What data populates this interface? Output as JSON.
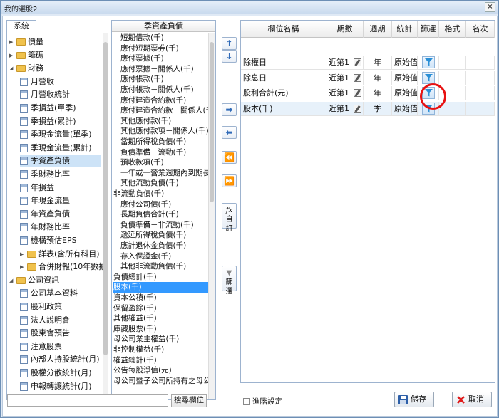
{
  "window": {
    "title": "我的選股2",
    "close_glyph": "×"
  },
  "left_tab": "系統",
  "tree": [
    {
      "label": "價量",
      "type": "folder",
      "level": 0,
      "expand": "▶"
    },
    {
      "label": "籌碼",
      "type": "folder",
      "level": 0,
      "expand": "▶"
    },
    {
      "label": "財務",
      "type": "folder",
      "level": 0,
      "expand": "◢"
    },
    {
      "label": "月營收",
      "type": "doc",
      "level": 1
    },
    {
      "label": "月營收統計",
      "type": "doc",
      "level": 1
    },
    {
      "label": "季損益(單季)",
      "type": "doc",
      "level": 1
    },
    {
      "label": "季損益(累計)",
      "type": "doc",
      "level": 1
    },
    {
      "label": "季現金流量(單季)",
      "type": "doc",
      "level": 1
    },
    {
      "label": "季現金流量(累計)",
      "type": "doc",
      "level": 1
    },
    {
      "label": "季資產負債",
      "type": "doc",
      "level": 1,
      "selected": true
    },
    {
      "label": "季財務比率",
      "type": "doc",
      "level": 1
    },
    {
      "label": "年損益",
      "type": "doc",
      "level": 1
    },
    {
      "label": "年現金流量",
      "type": "doc",
      "level": 1
    },
    {
      "label": "年資產負債",
      "type": "doc",
      "level": 1
    },
    {
      "label": "年財務比率",
      "type": "doc",
      "level": 1
    },
    {
      "label": "機構預估EPS",
      "type": "doc",
      "level": 1
    },
    {
      "label": "詳表(含所有科目)",
      "type": "folder",
      "level": 1,
      "expand": "▶"
    },
    {
      "label": "合併財報(10年數據)",
      "type": "folder",
      "level": 1,
      "expand": "▶"
    },
    {
      "label": "公司資訊",
      "type": "folder",
      "level": 0,
      "expand": "◢"
    },
    {
      "label": "公司基本資料",
      "type": "doc",
      "level": 1
    },
    {
      "label": "股利政策",
      "type": "doc",
      "level": 1
    },
    {
      "label": "法人說明會",
      "type": "doc",
      "level": 1
    },
    {
      "label": "股東會預告",
      "type": "doc",
      "level": 1
    },
    {
      "label": "注意股票",
      "type": "doc",
      "level": 1
    },
    {
      "label": "內部人持股統計(月)",
      "type": "doc",
      "level": 1
    },
    {
      "label": "股權分散統計(月)",
      "type": "doc",
      "level": 1
    },
    {
      "label": "申報轉讓統計(月)",
      "type": "doc",
      "level": 1
    }
  ],
  "field_list": {
    "header": "季資產負債",
    "items": [
      {
        "label": "短期借款(千)",
        "indent": 1
      },
      {
        "label": "應付短期票券(千)",
        "indent": 1
      },
      {
        "label": "應付票據(千)",
        "indent": 1
      },
      {
        "label": "應付票據－關係人(千)",
        "indent": 1
      },
      {
        "label": "應付帳款(千)",
        "indent": 1
      },
      {
        "label": "應付帳款－關係人(千)",
        "indent": 1
      },
      {
        "label": "應付建造合約款(千)",
        "indent": 1
      },
      {
        "label": "應付建造合約款－關係人(千)",
        "indent": 1
      },
      {
        "label": "其他應付款(千)",
        "indent": 1
      },
      {
        "label": "其他應付款項－關係人(千)",
        "indent": 1
      },
      {
        "label": "當期所得稅負債(千)",
        "indent": 1
      },
      {
        "label": "負債準備－流動(千)",
        "indent": 1
      },
      {
        "label": "預收款項(千)",
        "indent": 1
      },
      {
        "label": "一年或一營業週期內到期長期",
        "indent": 1
      },
      {
        "label": "其他流動負債(千)",
        "indent": 1
      },
      {
        "label": "非流動負債(千)",
        "indent": 0
      },
      {
        "label": "應付公司債(千)",
        "indent": 1
      },
      {
        "label": "長期負債合計(千)",
        "indent": 1
      },
      {
        "label": "負債準備－非流動(千)",
        "indent": 1
      },
      {
        "label": "遞延所得稅負債(千)",
        "indent": 1
      },
      {
        "label": "應計退休金負債(千)",
        "indent": 1
      },
      {
        "label": "存入保證金(千)",
        "indent": 1
      },
      {
        "label": "其他非流動負債(千)",
        "indent": 1
      },
      {
        "label": "負債總計(千)",
        "indent": 0
      },
      {
        "label": "股本(千)",
        "indent": 0,
        "selected": true
      },
      {
        "label": "資本公積(千)",
        "indent": 0
      },
      {
        "label": "保留盈餘(千)",
        "indent": 0
      },
      {
        "label": "其他權益(千)",
        "indent": 0
      },
      {
        "label": "庫藏股票(千)",
        "indent": 0
      },
      {
        "label": "母公司業主權益(千)",
        "indent": 0
      },
      {
        "label": "非控制權益(千)",
        "indent": 0
      },
      {
        "label": "權益總計(千)",
        "indent": 0
      },
      {
        "label": "公告每股淨值(元)",
        "indent": 0
      },
      {
        "label": "母公司暨子公司所持有之母公司",
        "indent": 0
      }
    ]
  },
  "middle_buttons": {
    "up": "↑",
    "down": "↓",
    "add": "➡",
    "remove": "⬅",
    "remove_all": "⏪",
    "add_all": "⏩",
    "custom_icon": "fx",
    "custom_label": "自訂",
    "filter_icon": "▼",
    "filter_label": "篩選"
  },
  "grid": {
    "columns": [
      "欄位名稱",
      "期數",
      "週期",
      "統計",
      "篩選",
      "格式",
      "名次"
    ],
    "rows": [
      {
        "name": "除權日",
        "period": "近第1",
        "cycle": "年",
        "stat": "原始值",
        "selected": false
      },
      {
        "name": "除息日",
        "period": "近第1",
        "cycle": "年",
        "stat": "原始值",
        "selected": false
      },
      {
        "name": "股利合計(元)",
        "period": "近第1",
        "cycle": "年",
        "stat": "原始值",
        "selected": false
      },
      {
        "name": "股本(千)",
        "period": "近第1",
        "cycle": "季",
        "stat": "原始值",
        "selected": true
      }
    ]
  },
  "bottom": {
    "search_value": "",
    "search_button": "搜尋欄位",
    "advanced_label": "進階設定",
    "save_label": "儲存",
    "cancel_label": "取消"
  },
  "colors": {
    "selection": "#3399ff",
    "accent_circle": "#e81212",
    "filter_icon": "#2a8fd6"
  }
}
